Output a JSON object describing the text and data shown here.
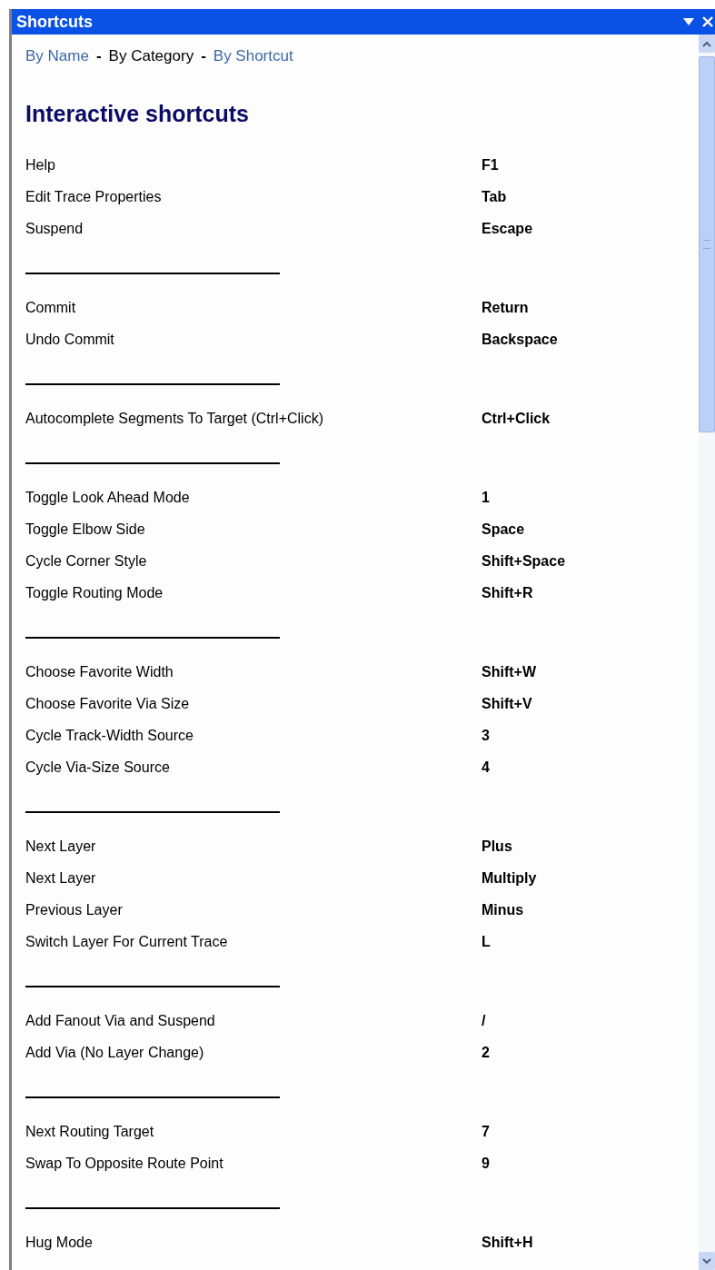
{
  "window": {
    "title": "Shortcuts"
  },
  "nav": [
    {
      "label": "By Name",
      "selected": false
    },
    {
      "label": "By Category",
      "selected": true
    },
    {
      "label": "By Shortcut",
      "selected": false
    }
  ],
  "nav_separator": "-",
  "heading": "Interactive shortcuts",
  "groups": [
    [
      {
        "action": "Help",
        "key": "F1"
      },
      {
        "action": "Edit Trace Properties",
        "key": "Tab"
      },
      {
        "action": "Suspend",
        "key": "Escape"
      }
    ],
    [
      {
        "action": "Commit",
        "key": "Return"
      },
      {
        "action": "Undo Commit",
        "key": "Backspace"
      }
    ],
    [
      {
        "action": "Autocomplete Segments To Target (Ctrl+Click)",
        "key": "Ctrl+Click"
      }
    ],
    [
      {
        "action": "Toggle Look Ahead Mode",
        "key": "1"
      },
      {
        "action": "Toggle Elbow Side",
        "key": "Space"
      },
      {
        "action": "Cycle Corner Style",
        "key": "Shift+Space"
      },
      {
        "action": "Toggle Routing Mode",
        "key": "Shift+R"
      }
    ],
    [
      {
        "action": "Choose Favorite Width",
        "key": "Shift+W"
      },
      {
        "action": "Choose Favorite Via Size",
        "key": "Shift+V"
      },
      {
        "action": "Cycle Track-Width Source",
        "key": "3"
      },
      {
        "action": "Cycle Via-Size Source",
        "key": "4"
      }
    ],
    [
      {
        "action": "Next Layer",
        "key": "Plus"
      },
      {
        "action": "Next Layer",
        "key": "Multiply"
      },
      {
        "action": "Previous Layer",
        "key": "Minus"
      },
      {
        "action": "Switch Layer For Current Trace",
        "key": "L"
      }
    ],
    [
      {
        "action": "Add Fanout Via and Suspend",
        "key": "/"
      },
      {
        "action": "Add Via (No Layer Change)",
        "key": "2"
      }
    ],
    [
      {
        "action": "Next Routing Target",
        "key": "7"
      },
      {
        "action": "Swap To Opposite Route Point",
        "key": "9"
      }
    ],
    [
      {
        "action": "Hug Mode",
        "key": "Shift+H"
      }
    ]
  ]
}
